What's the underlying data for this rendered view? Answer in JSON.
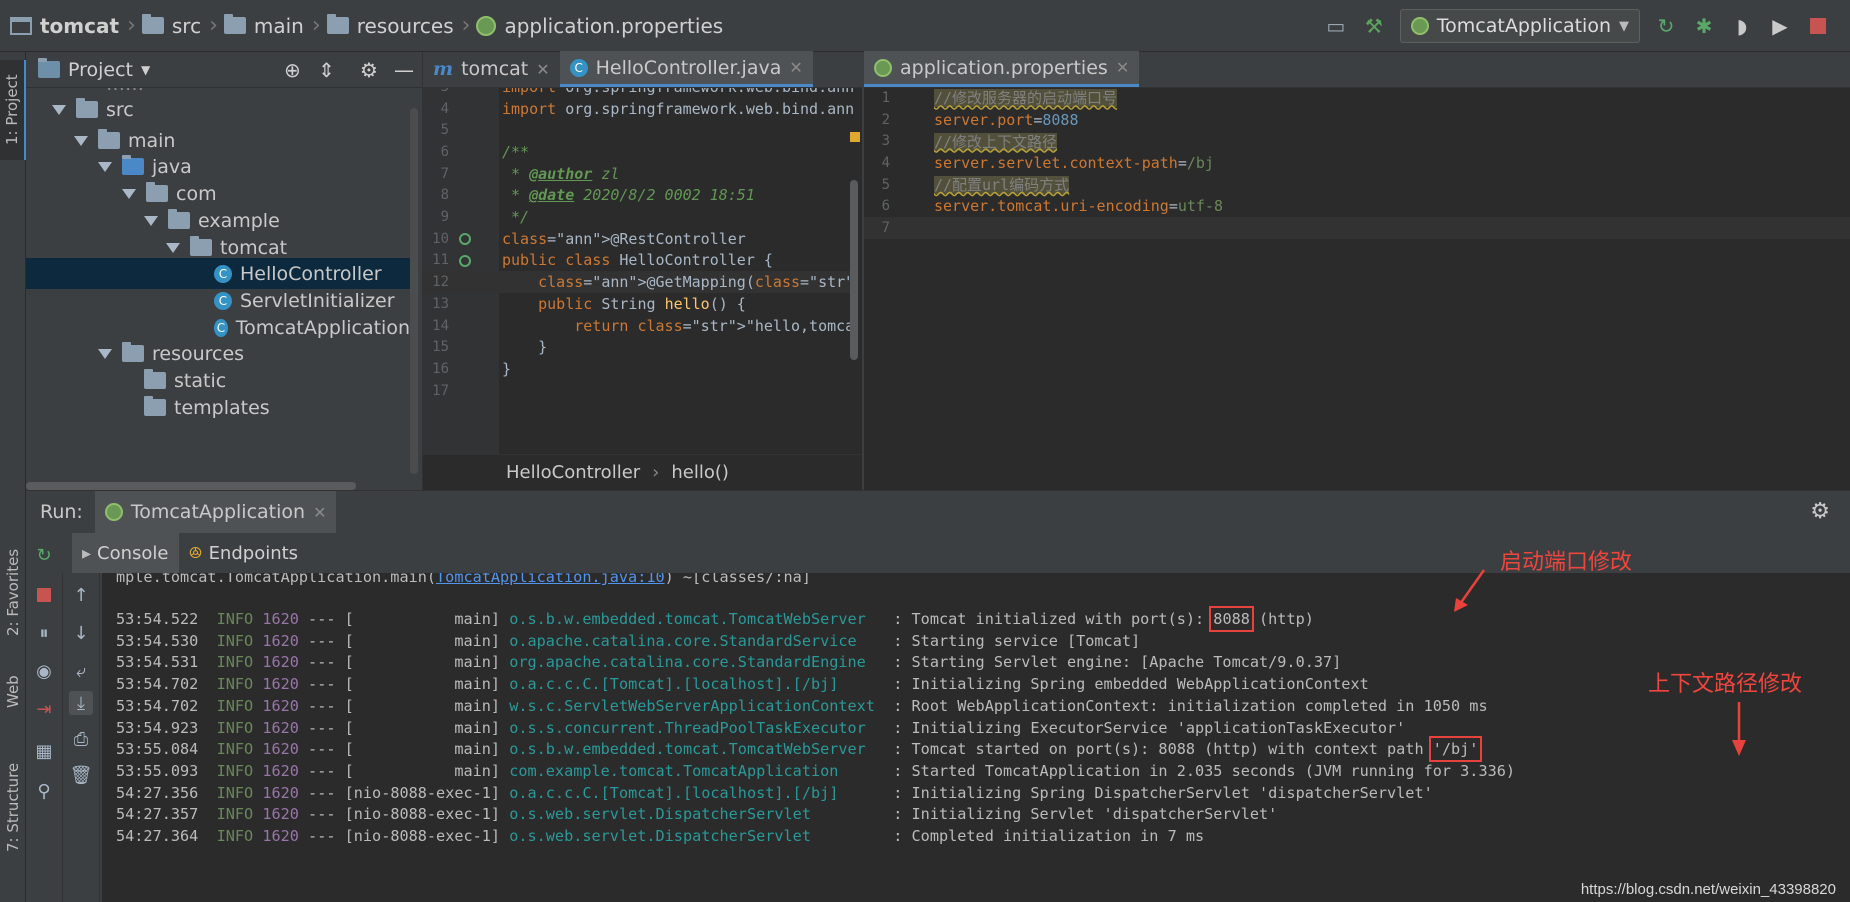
{
  "breadcrumb": [
    "tomcat",
    "src",
    "main",
    "resources",
    "application.properties"
  ],
  "run_config": "TomcatApplication",
  "project_panel": {
    "title": "Project",
    "tree": [
      {
        "label": "src",
        "type": "folder",
        "depth": 1,
        "expanded": true
      },
      {
        "label": "main",
        "type": "folder",
        "depth": 2,
        "expanded": true
      },
      {
        "label": "java",
        "type": "folder-source",
        "depth": 3,
        "expanded": true
      },
      {
        "label": "com",
        "type": "package",
        "depth": 4,
        "expanded": true
      },
      {
        "label": "example",
        "type": "package",
        "depth": 5,
        "expanded": true
      },
      {
        "label": "tomcat",
        "type": "package",
        "depth": 6,
        "expanded": true
      },
      {
        "label": "HelloController",
        "type": "class",
        "depth": 7,
        "selected": true
      },
      {
        "label": "ServletInitializer",
        "type": "class",
        "depth": 7
      },
      {
        "label": "TomcatApplication",
        "type": "class-spring",
        "depth": 7
      },
      {
        "label": "resources",
        "type": "folder-resources",
        "depth": 3,
        "expanded": true
      },
      {
        "label": "static",
        "type": "folder",
        "depth": 4
      },
      {
        "label": "templates",
        "type": "folder",
        "depth": 4
      }
    ]
  },
  "left_tabs": [
    "1: Project",
    "2: Favorites",
    "Web",
    "7: Structure"
  ],
  "editor_left": {
    "tabs": [
      {
        "label": "tomcat",
        "icon": "m-icon"
      },
      {
        "label": "HelloController.java",
        "icon": "class-icon",
        "active": true
      }
    ],
    "lines": [
      {
        "n": "3",
        "text": "import org.springframework.web.bind.ann"
      },
      {
        "n": "4",
        "text": "import org.springframework.web.bind.ann"
      },
      {
        "n": "5",
        "text": ""
      },
      {
        "n": "6",
        "text": "/**"
      },
      {
        "n": "7",
        "text": " * @author zl"
      },
      {
        "n": "8",
        "text": " * @date 2020/8/2 0002 18:51"
      },
      {
        "n": "9",
        "text": " */"
      },
      {
        "n": "10",
        "text": "@RestController"
      },
      {
        "n": "11",
        "text": "public class HelloController {"
      },
      {
        "n": "12",
        "text": "    @GetMapping(\"/hello\")"
      },
      {
        "n": "13",
        "text": "    public String hello() {"
      },
      {
        "n": "14",
        "text": "        return \"hello,tomcat!\";"
      },
      {
        "n": "15",
        "text": "    }"
      },
      {
        "n": "16",
        "text": "}"
      },
      {
        "n": "17",
        "text": ""
      }
    ],
    "crumbs": [
      "HelloController",
      "hello()"
    ]
  },
  "editor_right": {
    "tab": "application.properties",
    "lines": [
      {
        "n": "1",
        "text": "//修改服务器的启动端口号",
        "kind": "comment"
      },
      {
        "n": "2",
        "key": "server.port",
        "value": "8088"
      },
      {
        "n": "3",
        "text": "//修改上下文路径",
        "kind": "comment"
      },
      {
        "n": "4",
        "key": "server.servlet.context-path",
        "value": "/bj"
      },
      {
        "n": "5",
        "text": "//配置url编码方式",
        "kind": "comment"
      },
      {
        "n": "6",
        "key": "server.tomcat.uri-encoding",
        "value": "utf-8"
      },
      {
        "n": "7",
        "text": ""
      }
    ]
  },
  "run_panel": {
    "label": "Run:",
    "tab": "TomcatApplication",
    "subtabs": [
      "Console",
      "Endpoints"
    ],
    "partial_line": "mple.tomcat.TomcatApplication.main(TomcatApplication.java:10) ~[classes/:na]",
    "log": [
      {
        "time": "53:54.522",
        "level": "INFO",
        "pid": "1620",
        "thread": "[           main]",
        "logger": "o.s.b.w.embedded.tomcat.TomcatWebServer ",
        "msg": ": Tomcat initialized with port(s): ",
        "hl": "8088",
        "tail": " (http)"
      },
      {
        "time": "53:54.530",
        "level": "INFO",
        "pid": "1620",
        "thread": "[           main]",
        "logger": "o.apache.catalina.core.StandardService  ",
        "msg": ": Starting service [Tomcat]"
      },
      {
        "time": "53:54.531",
        "level": "INFO",
        "pid": "1620",
        "thread": "[           main]",
        "logger": "org.apache.catalina.core.StandardEngine ",
        "msg": ": Starting Servlet engine: [Apache Tomcat/9.0.37]"
      },
      {
        "time": "53:54.702",
        "level": "INFO",
        "pid": "1620",
        "thread": "[           main]",
        "logger": "o.a.c.c.C.[Tomcat].[localhost].[/bj]    ",
        "msg": ": Initializing Spring embedded WebApplicationContext"
      },
      {
        "time": "53:54.702",
        "level": "INFO",
        "pid": "1620",
        "thread": "[           main]",
        "logger": "w.s.c.ServletWebServerApplicationContext",
        "msg": ": Root WebApplicationContext: initialization completed in 1050 ms"
      },
      {
        "time": "53:54.923",
        "level": "INFO",
        "pid": "1620",
        "thread": "[           main]",
        "logger": "o.s.s.concurrent.ThreadPoolTaskExecutor ",
        "msg": ": Initializing ExecutorService 'applicationTaskExecutor'"
      },
      {
        "time": "53:55.084",
        "level": "INFO",
        "pid": "1620",
        "thread": "[           main]",
        "logger": "o.s.b.w.embedded.tomcat.TomcatWebServer ",
        "msg": ": Tomcat started on port(s): 8088 (http) with context path ",
        "hl": "'/bj'",
        "tail": ""
      },
      {
        "time": "53:55.093",
        "level": "INFO",
        "pid": "1620",
        "thread": "[           main]",
        "logger": "com.example.tomcat.TomcatApplication    ",
        "msg": ": Started TomcatApplication in 2.035 seconds (JVM running for 3.336)"
      },
      {
        "time": "54:27.356",
        "level": "INFO",
        "pid": "1620",
        "thread": "[nio-8088-exec-1]",
        "logger": "o.a.c.c.C.[Tomcat].[localhost].[/bj]    ",
        "msg": ": Initializing Spring DispatcherServlet 'dispatcherServlet'"
      },
      {
        "time": "54:27.357",
        "level": "INFO",
        "pid": "1620",
        "thread": "[nio-8088-exec-1]",
        "logger": "o.s.web.servlet.DispatcherServlet       ",
        "msg": ": Initializing Servlet 'dispatcherServlet'"
      },
      {
        "time": "54:27.364",
        "level": "INFO",
        "pid": "1620",
        "thread": "[nio-8088-exec-1]",
        "logger": "o.s.web.servlet.DispatcherServlet       ",
        "msg": ": Completed initialization in 7 ms"
      }
    ]
  },
  "annotations": {
    "port": "启动端口修改",
    "context": "上下文路径修改"
  },
  "watermark": "https://blog.csdn.net/weixin_43398820",
  "colors": {
    "keyword": "#cc7832",
    "annotation": "#bbb529",
    "string": "#6a8759",
    "number": "#6897bb",
    "highlight_red": "#e8423c"
  }
}
